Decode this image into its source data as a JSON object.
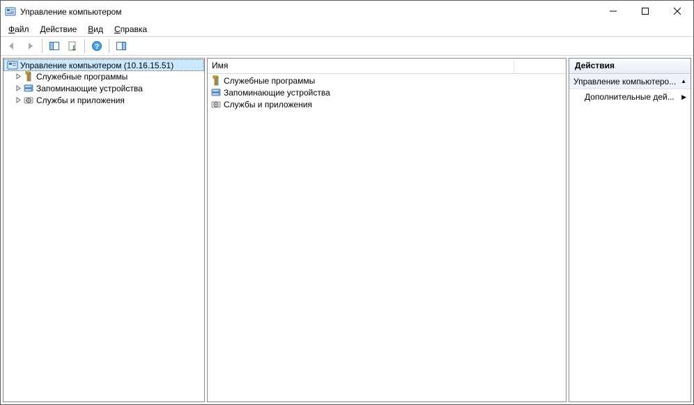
{
  "window": {
    "title": "Управление компьютером"
  },
  "menubar": {
    "file": {
      "label": "Файл",
      "accel": "Ф"
    },
    "action": {
      "label": "Действие",
      "accel": "Д"
    },
    "view": {
      "label": "Вид",
      "accel": "В"
    },
    "help": {
      "label": "Справка",
      "accel": "С"
    }
  },
  "tree": {
    "root": {
      "label": "Управление компьютером (10.16.15.51)"
    },
    "children": [
      {
        "label": "Служебные программы"
      },
      {
        "label": "Запоминающие устройства"
      },
      {
        "label": "Службы и приложения"
      }
    ]
  },
  "list": {
    "header_name": "Имя",
    "items": [
      {
        "label": "Служебные программы"
      },
      {
        "label": "Запоминающие устройства"
      },
      {
        "label": "Службы и приложения"
      }
    ]
  },
  "actions": {
    "header": "Действия",
    "context_label": "Управление компьютеро...",
    "more_label": "Дополнительные дей..."
  }
}
